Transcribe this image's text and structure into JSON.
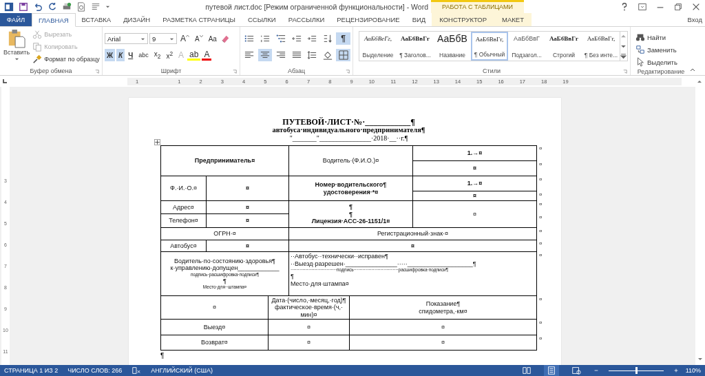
{
  "title_bar": {
    "title": "путевой лист.doc [Режим ограниченной функциональности] - Word",
    "context_label": "РАБОТА С ТАБЛИЦАМИ"
  },
  "tabs": [
    {
      "label": "ФАЙЛ",
      "kind": "file",
      "selected": false
    },
    {
      "label": "ГЛАВНАЯ",
      "kind": "normal",
      "selected": true
    },
    {
      "label": "ВСТАВКА",
      "kind": "normal",
      "selected": false
    },
    {
      "label": "ДИЗАЙН",
      "kind": "normal",
      "selected": false
    },
    {
      "label": "РАЗМЕТКА СТРАНИЦЫ",
      "kind": "normal",
      "selected": false
    },
    {
      "label": "ССЫЛКИ",
      "kind": "normal",
      "selected": false
    },
    {
      "label": "РАССЫЛКИ",
      "kind": "normal",
      "selected": false
    },
    {
      "label": "РЕЦЕНЗИРОВАНИЕ",
      "kind": "normal",
      "selected": false
    },
    {
      "label": "ВИД",
      "kind": "normal",
      "selected": false
    },
    {
      "label": "КОНСТРУКТОР",
      "kind": "contextual",
      "selected": false
    },
    {
      "label": "МАКЕТ",
      "kind": "contextual",
      "selected": false
    }
  ],
  "sign_in": "Вход",
  "clipboard": {
    "label": "Буфер обмена",
    "paste": "Вставить",
    "actions": [
      {
        "label": "Вырезать",
        "kind": "cut",
        "disabled": true
      },
      {
        "label": "Копировать",
        "kind": "copy",
        "disabled": true
      },
      {
        "label": "Формат по образцу",
        "kind": "brush",
        "disabled": false
      }
    ]
  },
  "font": {
    "label": "Шрифт",
    "name": "Arial",
    "size": "9",
    "grow": "A",
    "shrink": "A",
    "case": "Aa",
    "styles": [
      {
        "text": "Ж",
        "selected": true
      },
      {
        "text": "К",
        "selected": true
      },
      {
        "text": "Ч",
        "selected": false
      },
      {
        "text": "abc",
        "selected": false
      },
      {
        "text": "x$_{2}$",
        "selected": false
      },
      {
        "text": "x$^{2}$",
        "selected": false
      }
    ],
    "effects": [
      {
        "text": "A",
        "kind": "effects"
      },
      {
        "text": "ab",
        "kind": "highlight"
      },
      {
        "text": "A",
        "kind": "color"
      }
    ]
  },
  "paragraph": {
    "label": "Абзац",
    "top": [
      {
        "kind": "bullets",
        "selected": false
      },
      {
        "kind": "numbering",
        "selected": false
      },
      {
        "kind": "multilevel",
        "selected": false
      },
      {
        "kind": "outdent",
        "selected": false
      },
      {
        "kind": "indent",
        "selected": false
      },
      {
        "kind": "sort",
        "selected": false
      },
      {
        "kind": "pilcrow",
        "selected": true,
        "text": "¶"
      }
    ],
    "bottom": [
      {
        "kind": "align-left",
        "selected": false
      },
      {
        "kind": "align-center",
        "selected": true
      },
      {
        "kind": "align-right",
        "selected": false
      },
      {
        "kind": "justify",
        "selected": false
      },
      {
        "kind": "line-spacing",
        "selected": false
      },
      {
        "kind": "shading",
        "selected": false
      },
      {
        "kind": "borders",
        "selected": true
      }
    ]
  },
  "styles": {
    "label": "Стили",
    "items": [
      {
        "preview": "АаБбВеГг,",
        "name": "Выделение",
        "kind": "emphasis",
        "selected": false
      },
      {
        "preview": "АаБбВвГг",
        "name": "¶ Заголов...",
        "kind": "heading",
        "selected": false
      },
      {
        "preview": "АаБбВ",
        "name": "Название",
        "kind": "title",
        "selected": false
      },
      {
        "preview": "АаБбВвГг,",
        "name": "¶ Обычный",
        "kind": "normal",
        "selected": true
      },
      {
        "preview": "АаБбВвГ",
        "name": "Подзагол...",
        "kind": "subtitle",
        "selected": false
      },
      {
        "preview": "АаБбВвГг",
        "name": "Строгий",
        "kind": "strong",
        "selected": false
      },
      {
        "preview": "АаБбВвГг,",
        "name": "¶ Без инте...",
        "kind": "normal",
        "selected": false
      }
    ]
  },
  "editing": {
    "label": "Редактирование",
    "actions": [
      {
        "label": "Найти",
        "kind": "find"
      },
      {
        "label": "Заменить",
        "kind": "replace"
      },
      {
        "label": "Выделить",
        "kind": "select"
      }
    ]
  },
  "ruler": {
    "numbers": [
      "1",
      "1",
      "2",
      "3",
      "4",
      "5",
      "6",
      "7",
      "8",
      "9",
      "10",
      "11",
      "12",
      "13",
      "14",
      "15",
      "16",
      "17",
      "18",
      "19"
    ]
  },
  "vertical_ruler": {
    "numbers": [
      "3",
      "4",
      "5",
      "6",
      "7",
      "8",
      "9",
      "10",
      "11"
    ]
  },
  "document": {
    "heading": [
      {
        "kind": "title",
        "text": "ПУТЕВОЙ·ЛИСТ·№·___________¶"
      },
      {
        "kind": "subtitle",
        "text": "автобуса·индивидуального·предпринимателя¶"
      },
      {
        "kind": "date",
        "text": "\"_______\"_______________·2018·__··г.¶"
      }
    ],
    "table": {
      "cells": [
        {
          "lines": [
            {
              "kind": "bold",
              "text": "Предприниматель¤"
            }
          ]
        },
        {
          "lines": [
            {
              "kind": "normal",
              "text": "Водитель·(Ф.И.О.)¤"
            }
          ]
        },
        {
          "lines": [
            {
              "kind": "bold",
              "text": "1.→¤"
            }
          ]
        },
        {
          "lines": [
            {
              "kind": "bold",
              "text": "¤"
            }
          ]
        },
        {
          "lines": [
            {
              "kind": "normal",
              "text": "Ф.·И.·О.¤"
            }
          ]
        },
        {
          "lines": [
            {
              "kind": "bold",
              "text": "¤"
            }
          ]
        },
        {
          "lines": [
            {
              "kind": "bold",
              "text": "Номер·водительского¶"
            },
            {
              "kind": "bold",
              "text": "удостоверения·*¤"
            }
          ]
        },
        {
          "lines": [
            {
              "kind": "bold",
              "text": "1.→¤"
            }
          ]
        },
        {
          "lines": [
            {
              "kind": "bold",
              "text": "¤"
            }
          ]
        },
        {
          "lines": [
            {
              "kind": "normal",
              "text": "Адрес¤"
            }
          ]
        },
        {
          "lines": [
            {
              "kind": "bold",
              "text": "¤"
            }
          ]
        },
        {
          "lines": [
            {
              "kind": "bold",
              "text": "¶"
            },
            {
              "kind": "bold",
              "text": "¶"
            },
            {
              "kind": "bold",
              "text": "Лицензия·АСС-26-1151/1¤"
            }
          ]
        },
        {
          "lines": [
            {
              "kind": "normal",
              "text": "¤"
            }
          ]
        },
        {
          "lines": [
            {
              "kind": "normal",
              "text": "Телефон¤"
            }
          ]
        },
        {
          "lines": [
            {
              "kind": "bold",
              "text": "¤"
            }
          ]
        },
        {
          "lines": [
            {
              "kind": "normal",
              "text": "ОГРН·¤"
            }
          ]
        },
        {
          "lines": [
            {
              "kind": "normal",
              "text": "Регистрационный·знак·¤"
            }
          ]
        },
        {
          "lines": [
            {
              "kind": "normal",
              "text": "Автобус¤"
            }
          ]
        },
        {
          "lines": [
            {
              "kind": "bold",
              "text": "¤"
            }
          ]
        },
        {
          "lines": [
            {
              "kind": "bold",
              "text": "¤"
            }
          ]
        },
        {
          "lines": [
            {
              "kind": "normal",
              "text": "Водитель·по·состоянию·здоровья¶"
            },
            {
              "kind": "normal",
              "text": "к·управлению·допущен____________"
            },
            {
              "kind": "small",
              "text": "подпись·расшифровка·подписи¶"
            },
            {
              "kind": "normal",
              "text": "¶"
            },
            {
              "kind": "small",
              "text": "Место·для··штампа¤"
            }
          ]
        },
        {
          "lines": [
            {
              "kind": "normal",
              "text": "··Автобус··технически··исправен¶"
            },
            {
              "kind": "normal",
              "text": "··Выезд·разрешен·_______________·····___________________¶"
            },
            {
              "kind": "small",
              "text": "·······························подпись······························расшифровка·подписи¶"
            },
            {
              "kind": "normal",
              "text": "¶"
            },
            {
              "kind": "normal",
              "text": "Место·для·штампа¤"
            }
          ]
        },
        {
          "lines": [
            {
              "kind": "normal",
              "text": "¤"
            }
          ]
        },
        {
          "lines": [
            {
              "kind": "normal",
              "text": "Дата·(число,·месяц,·год)¶"
            },
            {
              "kind": "normal",
              "text": "фактическое·время·(ч,·"
            },
            {
              "kind": "normal",
              "text": "мин)¤"
            }
          ]
        },
        {
          "lines": [
            {
              "kind": "normal",
              "text": "Показание¶"
            },
            {
              "kind": "normal",
              "text": "спидометра,·км¤"
            }
          ]
        },
        {
          "lines": [
            {
              "kind": "normal",
              "text": "Выезд¤"
            }
          ]
        },
        {
          "lines": [
            {
              "kind": "normal",
              "text": "¤"
            }
          ]
        },
        {
          "lines": [
            {
              "kind": "normal",
              "text": "¤"
            }
          ]
        },
        {
          "lines": [
            {
              "kind": "normal",
              "text": "Возврат¤"
            }
          ]
        },
        {
          "lines": [
            {
              "kind": "normal",
              "text": "¤"
            }
          ]
        },
        {
          "lines": [
            {
              "kind": "normal",
              "text": "¤"
            }
          ]
        }
      ],
      "row_marks": [
        "¤",
        "¤",
        "¤",
        "¤",
        "¤",
        "¤",
        "¤",
        "¤",
        "¤",
        "¤",
        "¤",
        "¤"
      ]
    },
    "after_table": [
      "¶"
    ]
  },
  "status_bar": {
    "page": "СТРАНИЦА 1 ИЗ 2",
    "words": "ЧИСЛО СЛОВ: 266",
    "language": "АНГЛИЙСКИЙ (США)",
    "views": [
      {
        "kind": "read",
        "selected": false
      },
      {
        "kind": "print",
        "selected": true
      },
      {
        "kind": "web",
        "selected": false
      }
    ],
    "zoom": {
      "level": 0.5,
      "label": "110%"
    }
  }
}
